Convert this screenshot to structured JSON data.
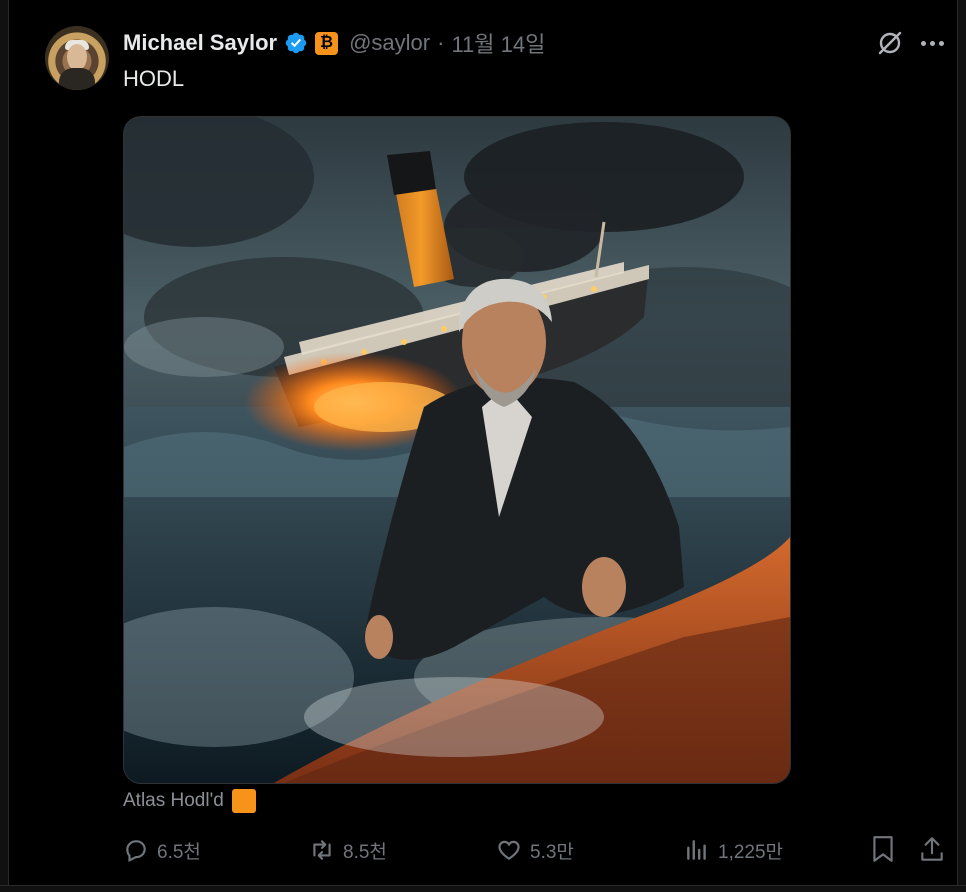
{
  "author": {
    "name": "Michael Saylor",
    "badge_letter": "₿",
    "handle": "@saylor",
    "separator": "·",
    "date": "11월 14일"
  },
  "tweet": {
    "text": "HODL"
  },
  "media": {
    "caption": "Atlas Hodl'd"
  },
  "actions": {
    "reply_count": "6.5천",
    "retweet_count": "8.5천",
    "like_count": "5.3만",
    "view_count": "1,225만"
  },
  "colors": {
    "background": "#000000",
    "verified": "#1d9bf0",
    "bitcoin_orange": "#f7931a",
    "secondary_text": "#71767b"
  },
  "icons": [
    "grok-icon",
    "more-icon",
    "reply-icon",
    "retweet-icon",
    "like-icon",
    "views-icon",
    "bookmark-icon",
    "share-icon",
    "verified-badge-icon"
  ]
}
